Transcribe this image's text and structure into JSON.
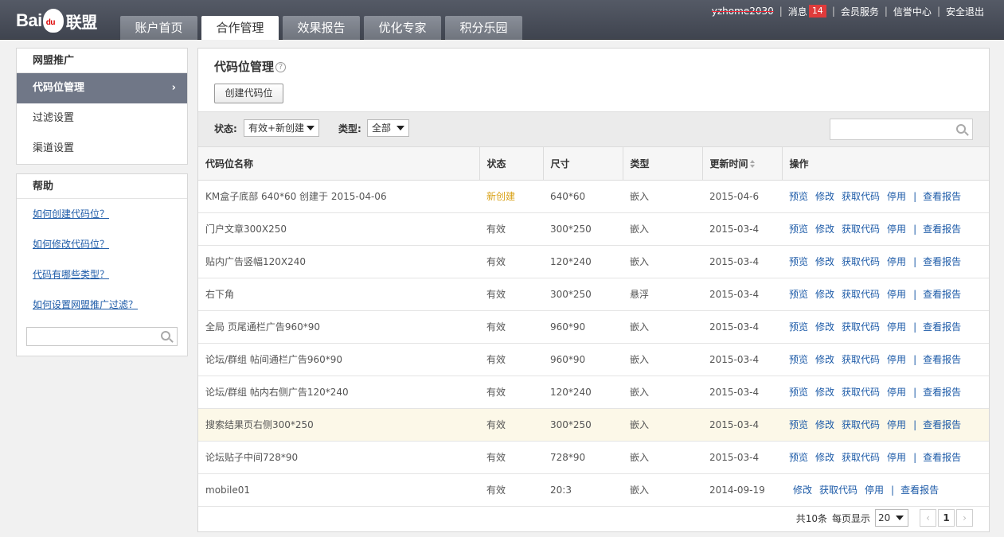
{
  "header": {
    "logo_text_left": "Bai",
    "logo_text_paw": "du",
    "logo_text_right": "联盟",
    "tabs": [
      {
        "label": "账户首页"
      },
      {
        "label": "合作管理",
        "active": true
      },
      {
        "label": "效果报告"
      },
      {
        "label": "优化专家"
      },
      {
        "label": "积分乐园"
      }
    ],
    "user_name": "yzhome2030",
    "messages_label": "消息",
    "messages_count": "14",
    "member_service": "会员服务",
    "credit_center": "信誉中心",
    "logout": "安全退出"
  },
  "sidebar": {
    "promo_title": "网盟推广",
    "items": [
      {
        "label": "代码位管理",
        "chevron": "›",
        "active": true
      },
      {
        "label": "过滤设置"
      },
      {
        "label": "渠道设置"
      }
    ],
    "help_title": "帮助",
    "help_links": [
      {
        "label": "如何创建代码位？"
      },
      {
        "label": "如何修改代码位？"
      },
      {
        "label": "代码有哪些类型？"
      },
      {
        "label": "如何设置网盟推广过滤？"
      }
    ]
  },
  "main": {
    "title": "代码位管理",
    "help_icon": "?",
    "create_button": "创建代码位",
    "filter": {
      "status_label": "状态:",
      "status_value": "有效+新创建",
      "type_label": "类型:",
      "type_value": "全部"
    },
    "table": {
      "headers": [
        "代码位名称",
        "状态",
        "尺寸",
        "类型",
        "更新时间",
        "操作"
      ],
      "rows": [
        {
          "name": "KM盒子底部 640*60 创建于 2015-04-06",
          "status": "新创建",
          "size": "640*60",
          "type": "嵌入",
          "date": "2015-04-6",
          "ops": [
            "预览",
            "修改",
            "获取代码",
            "停用"
          ],
          "report": "查看报告"
        },
        {
          "name": "门户文章300X250",
          "status": "有效",
          "size": "300*250",
          "type": "嵌入",
          "date": "2015-03-4",
          "ops": [
            "预览",
            "修改",
            "获取代码",
            "停用"
          ],
          "report": "查看报告"
        },
        {
          "name": "贴内广告竖幅120X240",
          "status": "有效",
          "size": "120*240",
          "type": "嵌入",
          "date": "2015-03-4",
          "ops": [
            "预览",
            "修改",
            "获取代码",
            "停用"
          ],
          "report": "查看报告"
        },
        {
          "name": "右下角",
          "status": "有效",
          "size": "300*250",
          "type": "悬浮",
          "date": "2015-03-4",
          "ops": [
            "预览",
            "修改",
            "获取代码",
            "停用"
          ],
          "report": "查看报告"
        },
        {
          "name": "全局 页尾通栏广告960*90",
          "status": "有效",
          "size": "960*90",
          "type": "嵌入",
          "date": "2015-03-4",
          "ops": [
            "预览",
            "修改",
            "获取代码",
            "停用"
          ],
          "report": "查看报告"
        },
        {
          "name": "论坛/群组 帖间通栏广告960*90",
          "status": "有效",
          "size": "960*90",
          "type": "嵌入",
          "date": "2015-03-4",
          "ops": [
            "预览",
            "修改",
            "获取代码",
            "停用"
          ],
          "report": "查看报告"
        },
        {
          "name": "论坛/群组 帖内右侧广告120*240",
          "status": "有效",
          "size": "120*240",
          "type": "嵌入",
          "date": "2015-03-4",
          "ops": [
            "预览",
            "修改",
            "获取代码",
            "停用"
          ],
          "report": "查看报告"
        },
        {
          "name": "搜索结果页右侧300*250",
          "status": "有效",
          "size": "300*250",
          "type": "嵌入",
          "date": "2015-03-4",
          "ops": [
            "预览",
            "修改",
            "获取代码",
            "停用"
          ],
          "report": "查看报告",
          "highlight": true
        },
        {
          "name": "论坛贴子中间728*90",
          "status": "有效",
          "size": "728*90",
          "type": "嵌入",
          "date": "2015-03-4",
          "ops": [
            "预览",
            "修改",
            "获取代码",
            "停用"
          ],
          "report": "查看报告"
        },
        {
          "name": "mobile01",
          "status": "有效",
          "size": "20:3",
          "type": "嵌入",
          "date": "2014-09-19",
          "ops": [
            "修改",
            "获取代码",
            "停用"
          ],
          "report": "查看报告"
        }
      ]
    },
    "pager": {
      "total": "共10条",
      "per_page_label": "每页显示",
      "per_page_value": "20",
      "prev": "‹",
      "current": "1",
      "next": "›"
    }
  },
  "colors": {
    "topbar": "#4a4f5a",
    "active_side": "#707787",
    "link": "#1d5ba8",
    "new_status": "#d9a217",
    "badge": "#e03b3b"
  }
}
